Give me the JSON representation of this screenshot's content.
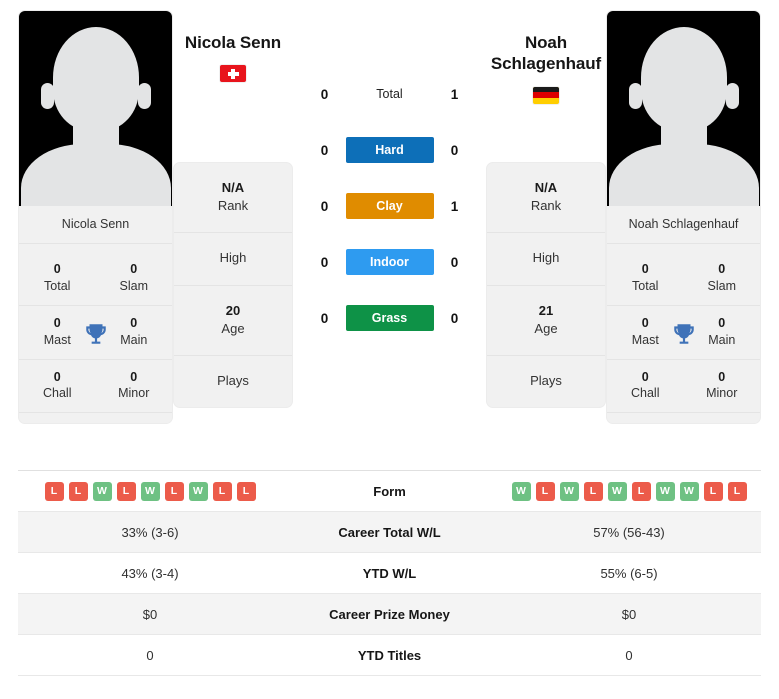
{
  "players": {
    "left": {
      "name": "Nicola Senn",
      "flag": "switzerland-flag",
      "card_name": "Nicola Senn",
      "rank_value": "N/A",
      "rank_label": "Rank",
      "high_label": "High",
      "age_value": "20",
      "age_label": "Age",
      "plays_label": "Plays",
      "titles": {
        "total_value": "0",
        "total_label": "Total",
        "slam_value": "0",
        "slam_label": "Slam",
        "mast_value": "0",
        "mast_label": "Mast",
        "main_value": "0",
        "main_label": "Main",
        "chall_value": "0",
        "chall_label": "Chall",
        "minor_value": "0",
        "minor_label": "Minor"
      },
      "form": [
        "L",
        "L",
        "W",
        "L",
        "W",
        "L",
        "W",
        "L",
        "L"
      ],
      "career_total_wl": "33% (3-6)",
      "ytd_wl": "43% (3-4)",
      "career_prize_money": "$0",
      "ytd_titles": "0"
    },
    "right": {
      "name": "Noah Schlagenhauf",
      "flag": "germany-flag",
      "card_name": "Noah Schlagenhauf",
      "rank_value": "N/A",
      "rank_label": "Rank",
      "high_label": "High",
      "age_value": "21",
      "age_label": "Age",
      "plays_label": "Plays",
      "titles": {
        "total_value": "0",
        "total_label": "Total",
        "slam_value": "0",
        "slam_label": "Slam",
        "mast_value": "0",
        "mast_label": "Mast",
        "main_value": "0",
        "main_label": "Main",
        "chall_value": "0",
        "chall_label": "Chall",
        "minor_value": "0",
        "minor_label": "Minor"
      },
      "form": [
        "W",
        "L",
        "W",
        "L",
        "W",
        "L",
        "W",
        "W",
        "L",
        "L"
      ],
      "career_total_wl": "57% (56-43)",
      "ytd_wl": "55% (6-5)",
      "career_prize_money": "$0",
      "ytd_titles": "0"
    }
  },
  "head_to_head": [
    {
      "label": "Total",
      "left": "0",
      "right": "1",
      "color": "transparent"
    },
    {
      "label": "Hard",
      "left": "0",
      "right": "0",
      "color": "#0d6fb8"
    },
    {
      "label": "Clay",
      "left": "0",
      "right": "1",
      "color": "#e08c00"
    },
    {
      "label": "Indoor",
      "left": "0",
      "right": "0",
      "color": "#2e9bf0"
    },
    {
      "label": "Grass",
      "left": "0",
      "right": "0",
      "color": "#0e9247"
    }
  ],
  "table_rows": [
    {
      "label": "Form",
      "type": "form"
    },
    {
      "label": "Career Total W/L",
      "type": "text",
      "left": "33% (3-6)",
      "right": "57% (56-43)"
    },
    {
      "label": "YTD W/L",
      "type": "text",
      "left": "43% (3-4)",
      "right": "55% (6-5)"
    },
    {
      "label": "Career Prize Money",
      "type": "text",
      "left": "$0",
      "right": "$0"
    },
    {
      "label": "YTD Titles",
      "type": "text",
      "left": "0",
      "right": "0"
    }
  ],
  "colors": {
    "hard": "#0d6fb8",
    "clay": "#e08c00",
    "indoor": "#2e9bf0",
    "grass": "#0e9247",
    "win": "#6ec183",
    "loss": "#ec5b4a",
    "trophy": "#3f72b8"
  }
}
